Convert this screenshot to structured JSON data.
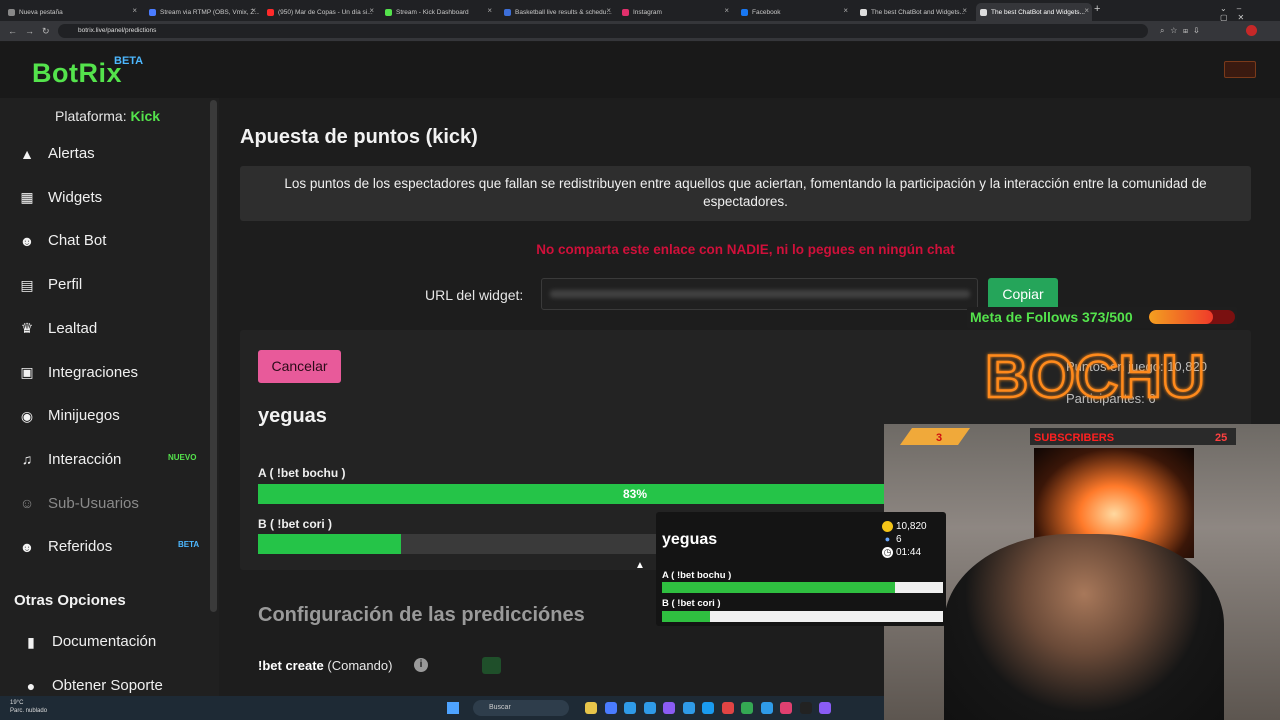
{
  "browser": {
    "tabs": [
      {
        "label": "Nueva pestaña",
        "color": "#888888"
      },
      {
        "label": "Stream via RTMP (OBS, Vmix, Z...",
        "color": "#4a7cff"
      },
      {
        "label": "(950) Mar de Copas - Un día si...",
        "color": "#ff2a2a"
      },
      {
        "label": "Stream - Kick Dashboard",
        "color": "#54e34c"
      },
      {
        "label": "Basketball live results & schedu...",
        "color": "#3d6fd9"
      },
      {
        "label": "Instagram",
        "color": "#e1306c"
      },
      {
        "label": "Facebook",
        "color": "#1877f2"
      },
      {
        "label": "The best ChatBot and Widgets...",
        "color": "#dddddd"
      },
      {
        "label": "The best ChatBot and Widgets...",
        "color": "#dddddd"
      }
    ],
    "url": "botrix.live/panel/predictions"
  },
  "app": {
    "logo": "BotRix",
    "logo_badge": "BETA",
    "platform_label": "Plataforma:",
    "platform_value": "Kick"
  },
  "sidebar": {
    "items": [
      {
        "label": "Alertas",
        "icon": "warning-icon"
      },
      {
        "label": "Widgets",
        "icon": "grid-icon"
      },
      {
        "label": "Chat Bot",
        "icon": "robot-icon"
      },
      {
        "label": "Perfil",
        "icon": "id-card-icon"
      },
      {
        "label": "Lealtad",
        "icon": "trophy-icon"
      },
      {
        "label": "Integraciones",
        "icon": "integration-icon"
      },
      {
        "label": "Minijuegos",
        "icon": "gamepad-icon"
      },
      {
        "label": "Interacción",
        "icon": "music-icon",
        "badge": "NUEVO"
      },
      {
        "label": "Sub-Usuarios",
        "icon": "users-icon"
      },
      {
        "label": "Referidos",
        "icon": "referral-icon",
        "badge": "BETA"
      }
    ],
    "section_title": "Otras Opciones",
    "other_items": [
      {
        "label": "Documentación",
        "icon": "book-icon"
      },
      {
        "label": "Obtener Soporte",
        "icon": "support-icon"
      }
    ]
  },
  "main": {
    "title": "Apuesta de puntos (kick)",
    "info": "Los puntos de los espectadores que fallan se redistribuyen entre aquellos que aciertan, fomentando la participación y la interacción entre la comunidad de espectadores.",
    "warning": "No comparta este enlace con NADIE, ni lo pegues en ningún chat",
    "url_label": "URL del widget:",
    "copy_button": "Copiar",
    "cancel_button": "Cancelar",
    "prediction_title": "yeguas",
    "options": [
      {
        "label": "A ( !bet bochu )",
        "percent_text": "83%",
        "fraction": 0.83
      },
      {
        "label": "B ( !bet cori )",
        "percent_text": "",
        "fraction": 0.17
      }
    ],
    "pool_label": "Puntos en juego:",
    "pool_value": "10,820",
    "participants_label": "Participantes:",
    "participants_value": "6",
    "config_title": "Configuración de las predicciónes",
    "config_command": "!bet create",
    "config_command_suffix": "(Comando)"
  },
  "overlay": {
    "follows_text": "Meta de Follows 373/500",
    "follows_fraction": 0.746,
    "brand": "BOCHU",
    "subs_left": "3",
    "subs_label": "SUBSCRIBERS",
    "subs_right": "25",
    "widget": {
      "title": "yeguas",
      "points": "10,820",
      "users": "6",
      "time": "01:44",
      "options": [
        {
          "label": "A ( !bet bochu )",
          "fraction": 0.83
        },
        {
          "label": "B ( !bet cori )",
          "fraction": 0.17
        }
      ]
    }
  },
  "taskbar": {
    "weather_temp": "19°C",
    "weather_desc": "Parc. nublado",
    "search_placeholder": "Buscar"
  }
}
